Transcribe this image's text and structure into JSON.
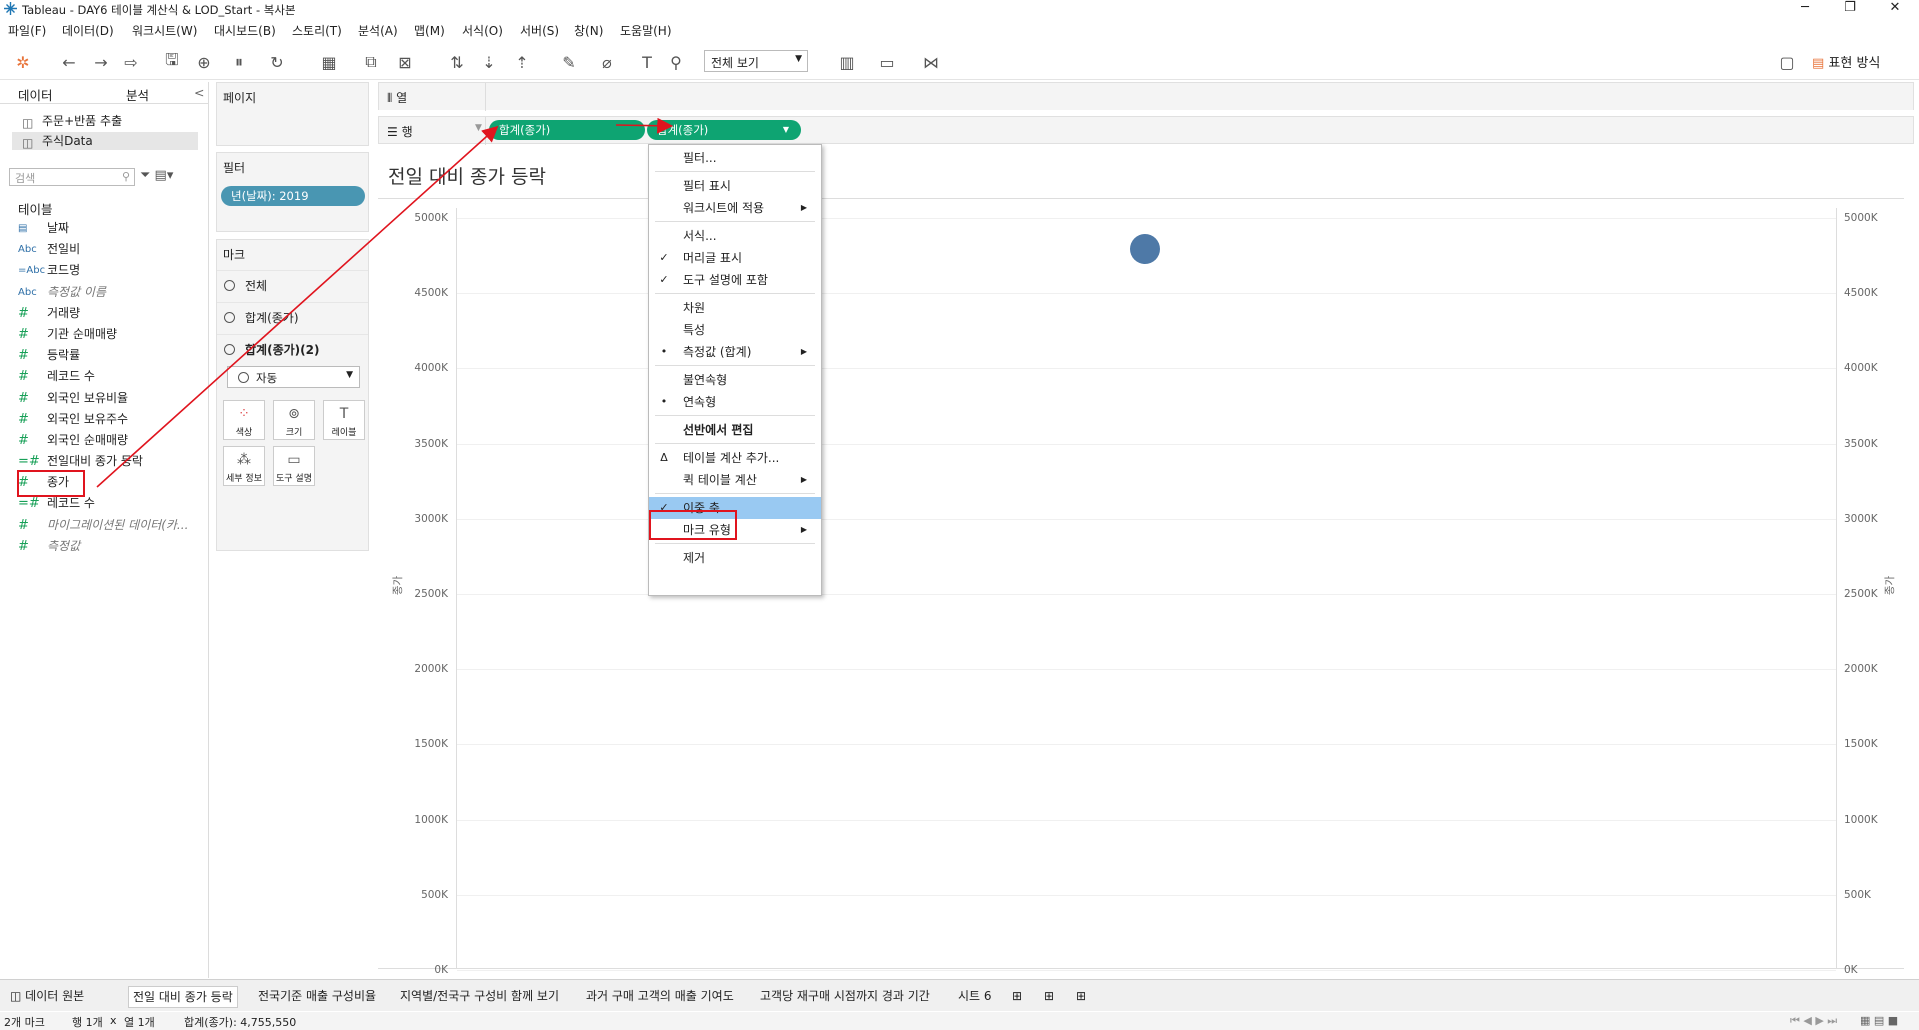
{
  "window": {
    "title": "Tableau - DAY6 테이블 계산식 & LOD_Start - 복사본"
  },
  "menu": [
    "파일(F)",
    "데이터(D)",
    "워크시트(W)",
    "대시보드(B)",
    "스토리(T)",
    "분석(A)",
    "맵(M)",
    "서식(O)",
    "서버(S)",
    "창(N)",
    "도움말(H)"
  ],
  "toolbar": {
    "fit_select": "전체 보기",
    "show_me": "표현 방식"
  },
  "left": {
    "tabs": [
      "데이터",
      "분석"
    ],
    "datasources": [
      "주문+반품 추출",
      "주식Data"
    ],
    "search_placeholder": "검색",
    "section": "테이블",
    "fields": [
      {
        "icon": "▤",
        "name": "날짜",
        "type": "dim"
      },
      {
        "icon": "Abc",
        "name": "전일비",
        "type": "dim"
      },
      {
        "icon": "=Abc",
        "name": "코드명",
        "type": "dim"
      },
      {
        "icon": "Abc",
        "name": "측정값 이름",
        "type": "dim",
        "italic": true
      },
      {
        "icon": "#",
        "name": "거래량",
        "type": "mea"
      },
      {
        "icon": "#",
        "name": "기관 순매매량",
        "type": "mea"
      },
      {
        "icon": "#",
        "name": "등락률",
        "type": "mea"
      },
      {
        "icon": "#",
        "name": "레코드 수",
        "type": "mea"
      },
      {
        "icon": "#",
        "name": "외국인 보유비율",
        "type": "mea"
      },
      {
        "icon": "#",
        "name": "외국인 보유주수",
        "type": "mea"
      },
      {
        "icon": "#",
        "name": "외국인 순매매량",
        "type": "mea"
      },
      {
        "icon": "=#",
        "name": "전일대비 종가 등락",
        "type": "mea"
      },
      {
        "icon": "#",
        "name": "종가",
        "type": "mea"
      },
      {
        "icon": "=#",
        "name": "레코드 수",
        "type": "mea"
      },
      {
        "icon": "#",
        "name": "마이그레이션된 데이터(카...",
        "type": "mea",
        "italic": true
      },
      {
        "icon": "#",
        "name": "측정값",
        "type": "mea",
        "italic": true
      }
    ]
  },
  "cards": {
    "pages": "페이지",
    "filters": {
      "title": "필터",
      "pill": "년(날짜): 2019"
    },
    "marks": {
      "title": "마크",
      "rows": [
        "전체",
        "합계(종가)",
        "합계(종가)(2)"
      ],
      "type": "자동",
      "buttons": [
        "색상",
        "크기",
        "레이블",
        "세부 정보",
        "도구 설명"
      ]
    }
  },
  "shelves": {
    "columns": {
      "label": "열"
    },
    "rows": {
      "label": "행",
      "pills": [
        "합계(종가)",
        "합계(종가)"
      ]
    }
  },
  "viz": {
    "title": "전일 대비 종가 등락",
    "y_axis_label": "종가",
    "ticks": [
      "5000K",
      "4500K",
      "4000K",
      "3500K",
      "3000K",
      "2500K",
      "2000K",
      "1500K",
      "1000K",
      "500K",
      "0K"
    ]
  },
  "context_menu": {
    "items": [
      {
        "label": "필터...",
        "mark": ""
      },
      {
        "sep": true
      },
      {
        "label": "필터 표시",
        "mark": ""
      },
      {
        "label": "워크시트에 적용",
        "mark": "",
        "sub": true
      },
      {
        "sep": true
      },
      {
        "label": "서식...",
        "mark": ""
      },
      {
        "label": "머리글 표시",
        "mark": "✓"
      },
      {
        "label": "도구 설명에 포함",
        "mark": "✓"
      },
      {
        "sep": true
      },
      {
        "label": "차원",
        "mark": ""
      },
      {
        "label": "특성",
        "mark": ""
      },
      {
        "label": "측정값 (합계)",
        "mark": "•",
        "sub": true
      },
      {
        "sep": true
      },
      {
        "label": "불연속형",
        "mark": ""
      },
      {
        "label": "연속형",
        "mark": "•"
      },
      {
        "sep": true
      },
      {
        "label": "선반에서 편집",
        "mark": "",
        "bold": true
      },
      {
        "sep": true
      },
      {
        "label": "테이블 계산 추가...",
        "mark": "Δ"
      },
      {
        "label": "퀵 테이블 계산",
        "mark": "",
        "sub": true
      },
      {
        "sep": true
      },
      {
        "label": "이중 축",
        "mark": "✓",
        "highlight": true
      },
      {
        "label": "마크 유형",
        "mark": "",
        "sub": true
      },
      {
        "sep": true
      },
      {
        "label": "제거",
        "mark": ""
      }
    ]
  },
  "bottom_tabs": [
    "데이터 원본",
    "전일 대비 종가 등락",
    "전국기준 매출 구성비율",
    "지역별/전국구 구성비 함께 보기",
    "과거 구매 고객의 매출 기여도",
    "고객당 재구매 시점까지 경과 기간",
    "시트 6"
  ],
  "status": {
    "marks": "2개 마크",
    "rows": "행 1개",
    "x": "x",
    "cols": "열 1개",
    "sum": "합계(종가): 4,755,550"
  },
  "colors": {
    "dim_pill": "#4996b2",
    "mea_pill": "#0ea472",
    "mark_dot": "#4e79a7",
    "highlight": "#99c9f2",
    "annotation": "#e0141e"
  }
}
